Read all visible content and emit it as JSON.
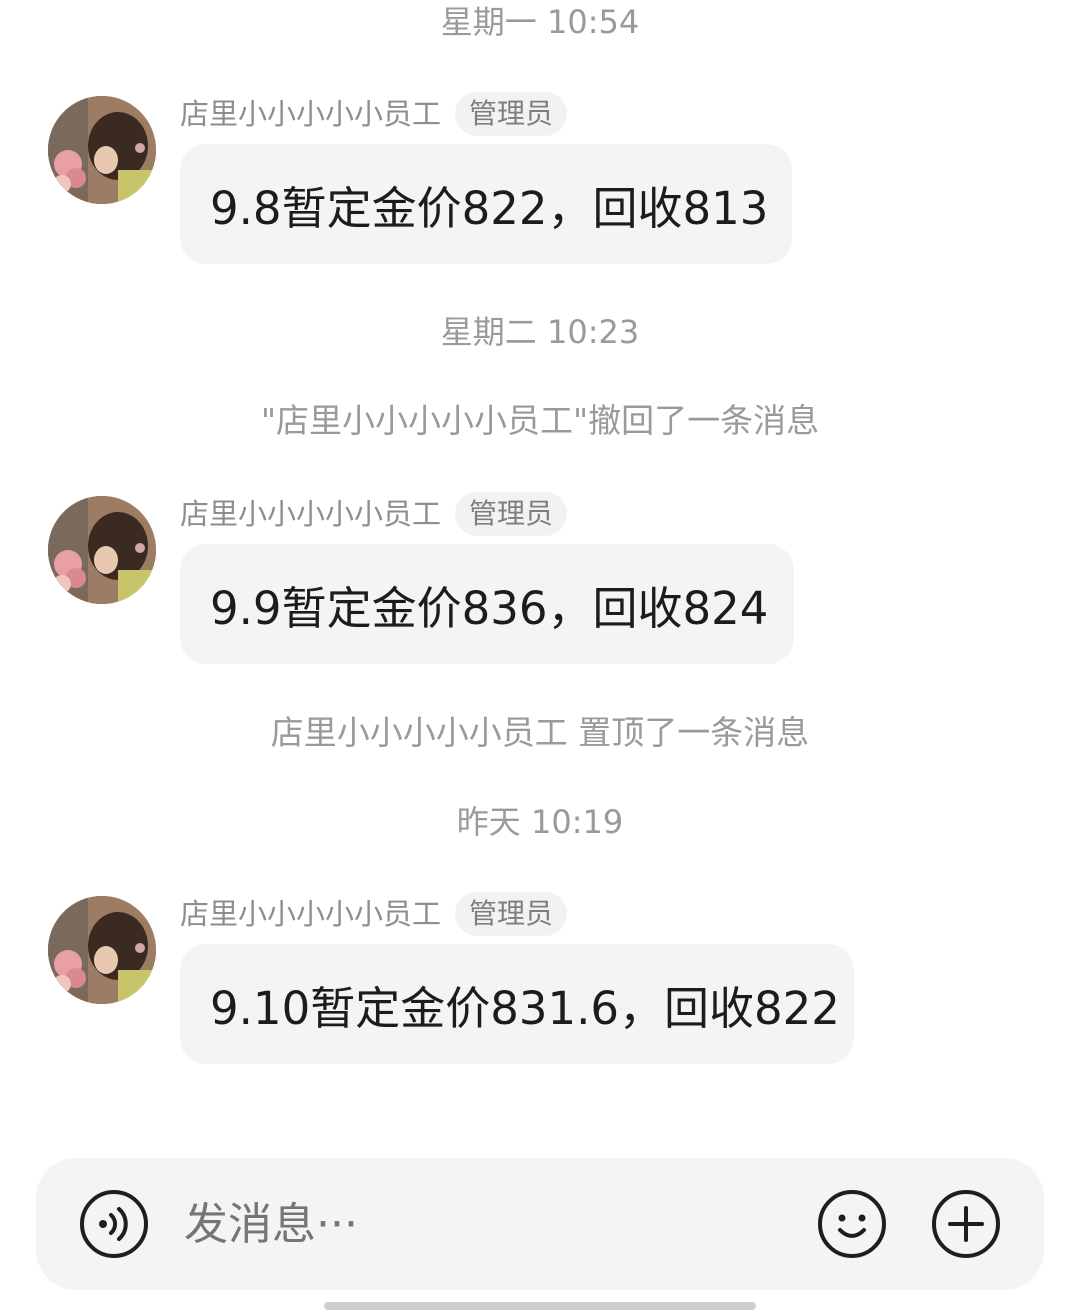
{
  "messages_area": {
    "time_1": "星期一 10:54",
    "msg_1": {
      "sender": "店里小小小小小员工",
      "role": "管理员",
      "text": "9.8暂定金价822，回收813"
    },
    "time_2": "星期二 10:23",
    "system_1": "\"店里小小小小小员工\"撤回了一条消息",
    "msg_2": {
      "sender": "店里小小小小小员工",
      "role": "管理员",
      "text": "9.9暂定金价836，回收824"
    },
    "system_2": "店里小小小小小员工 置顶了一条消息",
    "time_3": "昨天 10:19",
    "msg_3": {
      "sender": "店里小小小小小员工",
      "role": "管理员",
      "text": "9.10暂定金价831.6，回收822"
    }
  },
  "composer": {
    "placeholder": "发消息···",
    "voice_icon": "voice-icon",
    "emoji_icon": "emoji-icon",
    "plus_icon": "plus-icon"
  },
  "colors": {
    "bubble_bg": "#f4f4f5",
    "meta_text": "#9a9a9a",
    "composer_bg": "#f4f4f4"
  }
}
